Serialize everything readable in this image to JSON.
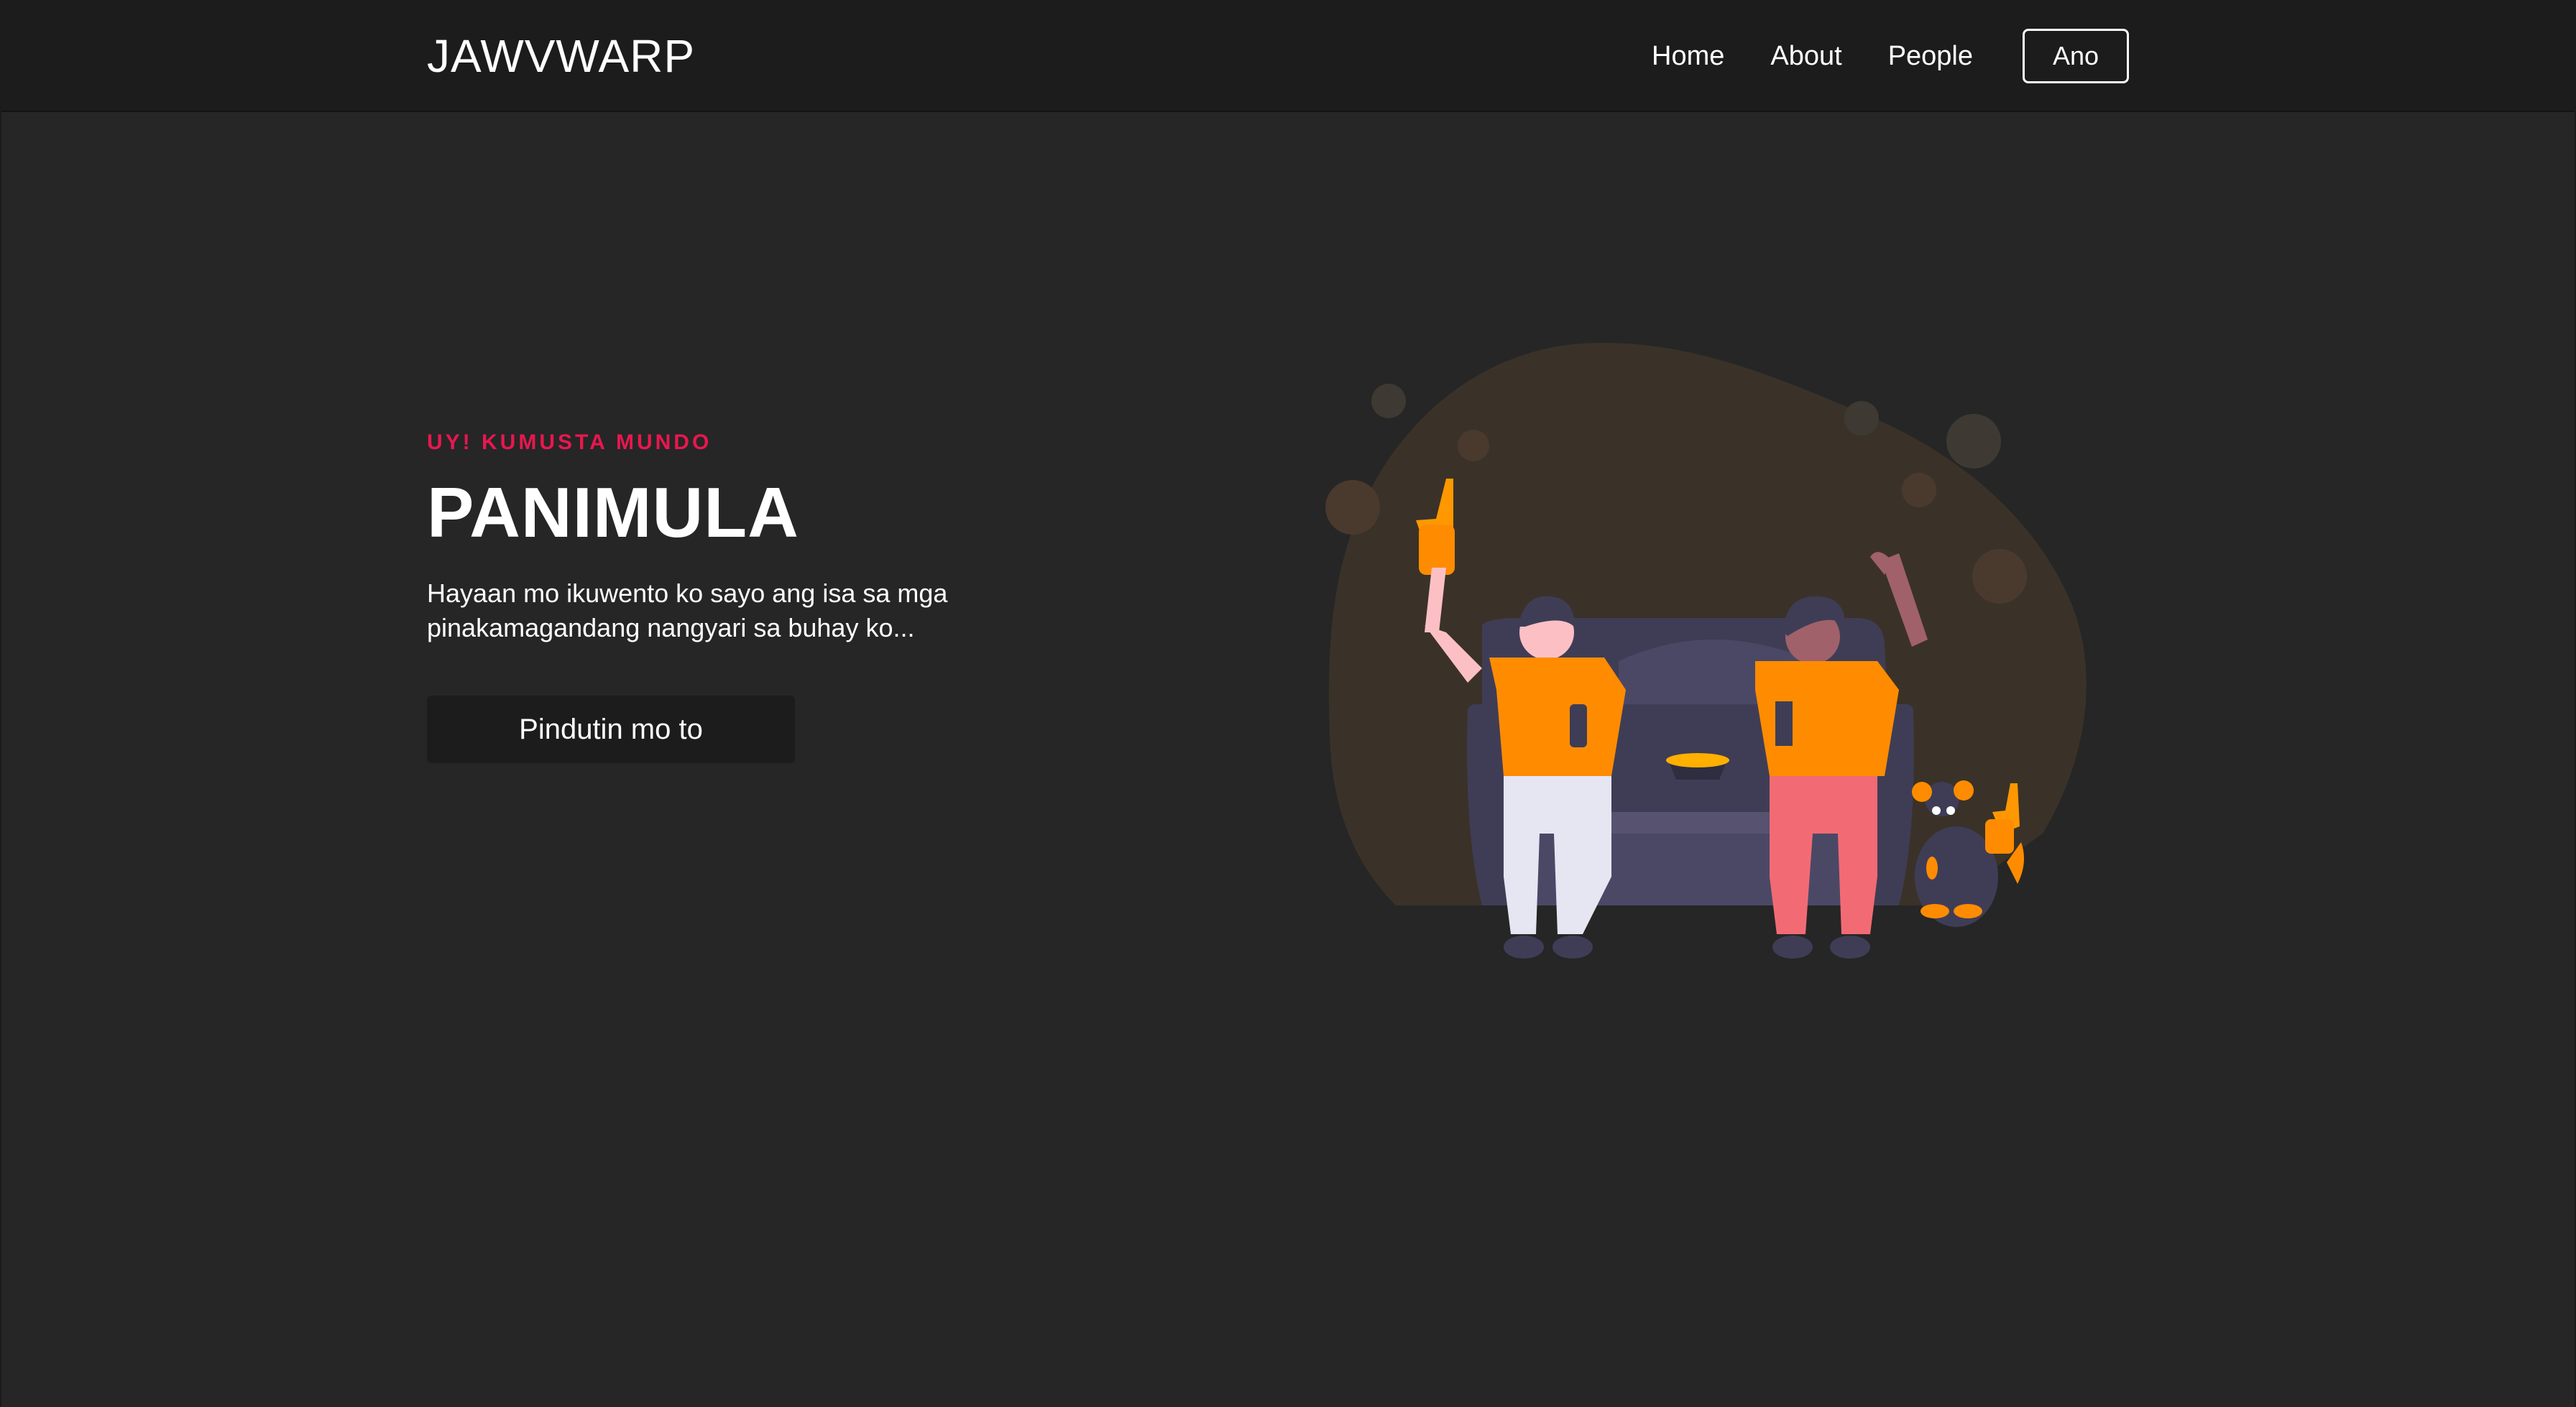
{
  "navbar": {
    "brand": "JAWVWARP",
    "links": [
      {
        "label": "Home"
      },
      {
        "label": "About"
      },
      {
        "label": "People"
      }
    ],
    "button_label": "Ano"
  },
  "hero": {
    "eyebrow": "UY! KUMUSTA MUNDO",
    "headline": "PANIMULA",
    "lead": "Hayaan mo ikuwento ko sayo ang isa sa mga pinakamagandang nangyari sa buhay ko...",
    "cta_label": "Pindutin mo to"
  },
  "colors": {
    "background": "#262626",
    "navbar": "#1c1c1c",
    "accent": "#e8174f",
    "illustration_orange": "#ff8c00",
    "illustration_sofa": "#3f3d56",
    "illustration_blob": "#3a3228"
  },
  "illustration": {
    "icon": "sports-fans-on-couch-illustration"
  }
}
